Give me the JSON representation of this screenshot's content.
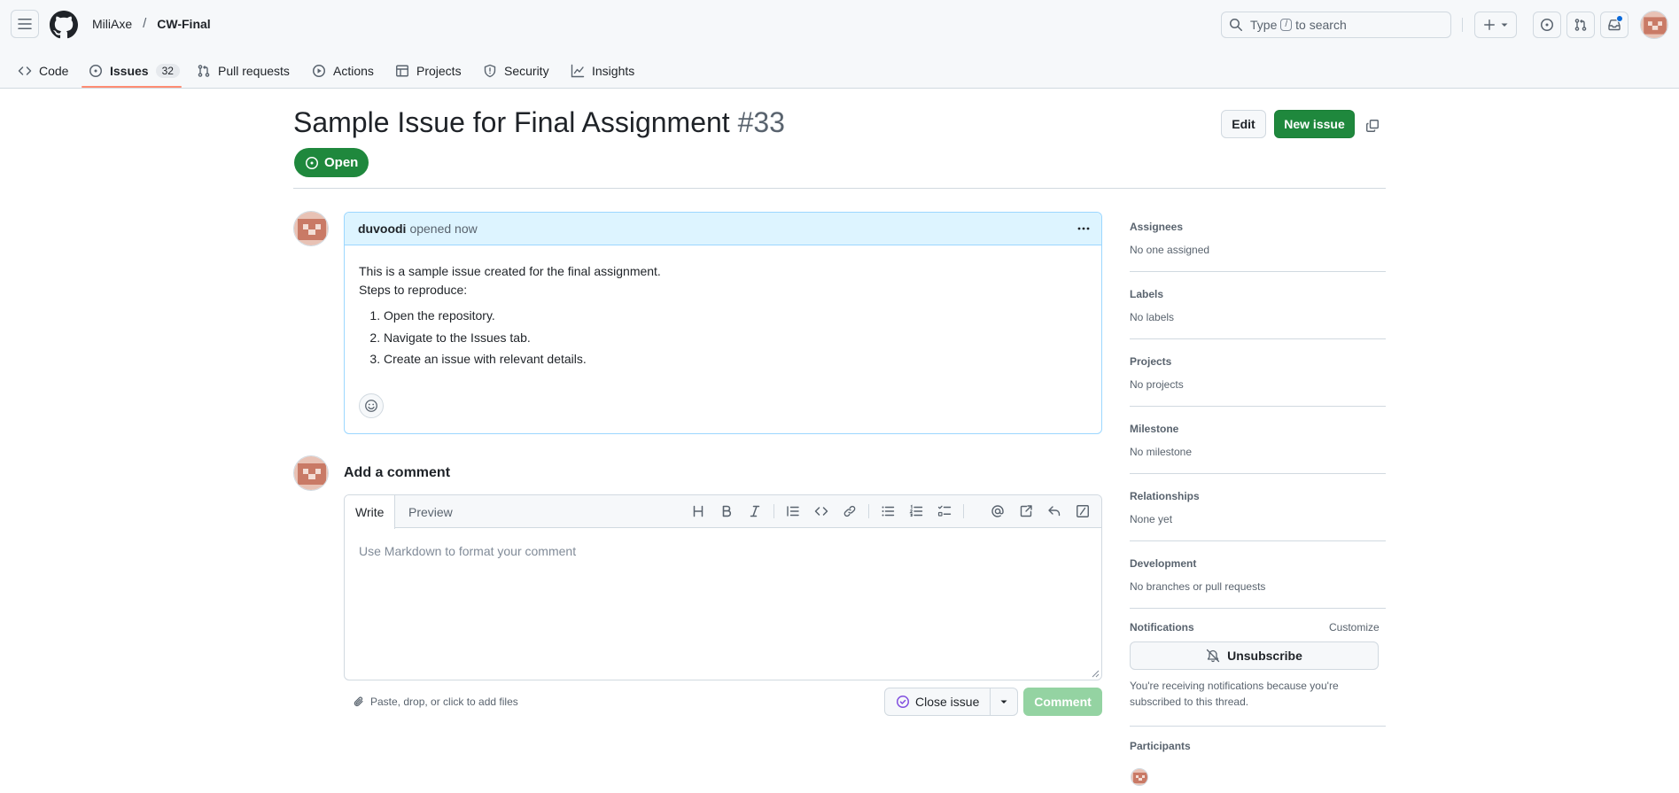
{
  "header": {
    "owner": "MiliAxe",
    "separator": "/",
    "repo": "CW-Final",
    "search": {
      "prefix": "Type",
      "key": "/",
      "suffix": "to search"
    }
  },
  "repo_nav": {
    "items": [
      {
        "label": "Code",
        "icon": "code-icon"
      },
      {
        "label": "Issues",
        "icon": "issue-opened-icon",
        "count": "32",
        "selected": true
      },
      {
        "label": "Pull requests",
        "icon": "git-pull-request-icon"
      },
      {
        "label": "Actions",
        "icon": "play-icon"
      },
      {
        "label": "Projects",
        "icon": "table-icon"
      },
      {
        "label": "Security",
        "icon": "shield-icon"
      },
      {
        "label": "Insights",
        "icon": "graph-icon"
      }
    ]
  },
  "issue": {
    "title": "Sample Issue for Final Assignment",
    "number": "#33",
    "state": "Open",
    "edit_label": "Edit",
    "new_issue_label": "New issue"
  },
  "comment": {
    "author": "duvoodi",
    "meta": "opened now",
    "body_line1": "This is a sample issue created for the final assignment.",
    "body_line2": "Steps to reproduce:",
    "steps": [
      "Open the repository.",
      "Navigate to the Issues tab.",
      "Create an issue with relevant details."
    ]
  },
  "add_comment": {
    "title": "Add a comment",
    "tab_write": "Write",
    "tab_preview": "Preview",
    "placeholder": "Use Markdown to format your comment",
    "attach_label": "Paste, drop, or click to add files",
    "close_issue_label": "Close issue",
    "comment_label": "Comment"
  },
  "sidebar": {
    "assignees": {
      "title": "Assignees",
      "value": "No one assigned"
    },
    "labels": {
      "title": "Labels",
      "value": "No labels"
    },
    "projects": {
      "title": "Projects",
      "value": "No projects"
    },
    "milestone": {
      "title": "Milestone",
      "value": "No milestone"
    },
    "relationships": {
      "title": "Relationships",
      "value": "None yet"
    },
    "development": {
      "title": "Development",
      "value": "No branches or pull requests"
    },
    "notifications": {
      "title": "Notifications",
      "customize": "Customize",
      "unsubscribe": "Unsubscribe",
      "info": "You're receiving notifications because you're subscribed to this thread."
    },
    "participants": {
      "title": "Participants"
    }
  },
  "colors": {
    "primary_green": "#1f883d",
    "disabled_green": "#94d3a2",
    "comment_header_bg": "#ddf4ff",
    "nav_underline": "#fd8c73",
    "avatar_bg": "#e8c2b5",
    "avatar_fg": "#c97a66"
  }
}
